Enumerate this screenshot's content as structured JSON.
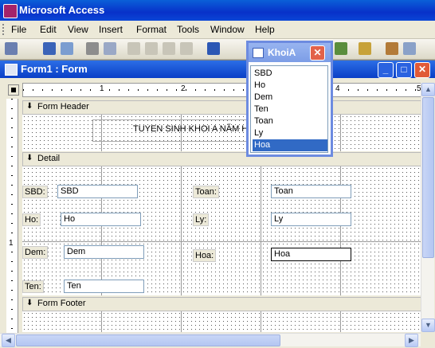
{
  "app": {
    "title": "Microsoft Access"
  },
  "menu": [
    "File",
    "Edit",
    "View",
    "Insert",
    "Format",
    "Tools",
    "Window",
    "Help"
  ],
  "form": {
    "title": "Form1 : Form",
    "sections": {
      "header": "Form Header",
      "detail": "Detail",
      "footer": "Form Footer"
    },
    "header_label": "TUYEN SINH KHOI A NĂM HC",
    "fields_left": [
      {
        "label": "SBD:",
        "value": "SBD"
      },
      {
        "label": "Ho:",
        "value": "Ho"
      },
      {
        "label": "Dem:",
        "value": "Dem"
      },
      {
        "label": "Ten:",
        "value": "Ten"
      }
    ],
    "fields_right": [
      {
        "label": "Toan:",
        "value": "Toan"
      },
      {
        "label": "Ly:",
        "value": "Ly"
      },
      {
        "label": "Hoa:",
        "value": "Hoa"
      }
    ],
    "ruler_marks": [
      "1",
      "2",
      "4",
      "5"
    ],
    "vruler_marks": [
      "1"
    ]
  },
  "popup": {
    "title": "KhoiA",
    "items": [
      "SBD",
      "Ho",
      "Dem",
      "Ten",
      "Toan",
      "Ly",
      "Hoa"
    ],
    "selected": "Hoa"
  }
}
